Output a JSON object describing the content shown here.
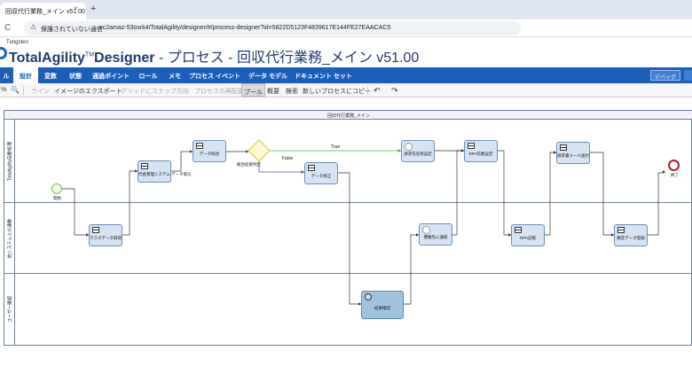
{
  "browser": {
    "tab_title": "回収代行業務_メイン v51.00",
    "tab_close": "×",
    "new_tab": "+",
    "reload": "C",
    "warning_icon": "⚠",
    "security_text": "保護されていない通信",
    "url": "ec2amaz-53osrk4/TotalAgility/designer/#/process-designer?id=5822D5123F4839617E144FE27EAACAC5"
  },
  "brand": {
    "company": "Tungsten",
    "product_a": "TotalAgility",
    "tm": "TM",
    "product_b": "Designer",
    "page_title": " - プロセス - 回収代行業務_メイン v51.00"
  },
  "menu": {
    "items": [
      "ル",
      "設計",
      "変数",
      "状態",
      "通過ポイント",
      "ロール",
      "メモ",
      "プロセス イベント",
      "データ モデル",
      "ドキュメント セット"
    ],
    "active": "設計",
    "debug_label": "デバッグ"
  },
  "toolbar": {
    "zoom_percent": "%",
    "zoom_icon": "🔍",
    "line": "ライン",
    "export_image": "イメージのエクスポート",
    "snap_grid": "グリッドにスナップ",
    "direction": "方向",
    "relayout": "プロセスの再配置",
    "pool": "プール",
    "overview": "概要",
    "search": "検索",
    "copy_as_new": "新しいプロセスにコピー",
    "undo_icon": "↶",
    "redo_icon": "↷"
  },
  "diagram": {
    "pool_title": "回収代行業務_メイン",
    "lanes": [
      "TotalAgility自動処理",
      "他システムとの連動",
      "ユーザー確認"
    ],
    "start_label": "開始",
    "end_label": "終了",
    "gateway_label": "総合結果判定",
    "flow_true": "True",
    "flow_false": "False",
    "tasks": {
      "master_fetch": "マスタデータ取得",
      "settlement": "代金管理システム データ取込",
      "reconcile": "データ照合",
      "data_adjust": "データ修正",
      "user_confirm": "結果確認",
      "customer_notify": "債権先に通知",
      "billing_settings": "請求先名称設定",
      "rpa_settings": "RPA先数設定",
      "rpa_record": "RPA記帳",
      "invoice_mail": "請求書メール送付",
      "confirm_register": "確定データ登録"
    }
  },
  "colors": {
    "accent": "#1d5fb8",
    "task_fill": "#d5e3f3",
    "user_task_fill": "#9fc3df",
    "start_event": "#76c043",
    "end_event": "#b01e2e",
    "gateway": "#e3cf30"
  }
}
